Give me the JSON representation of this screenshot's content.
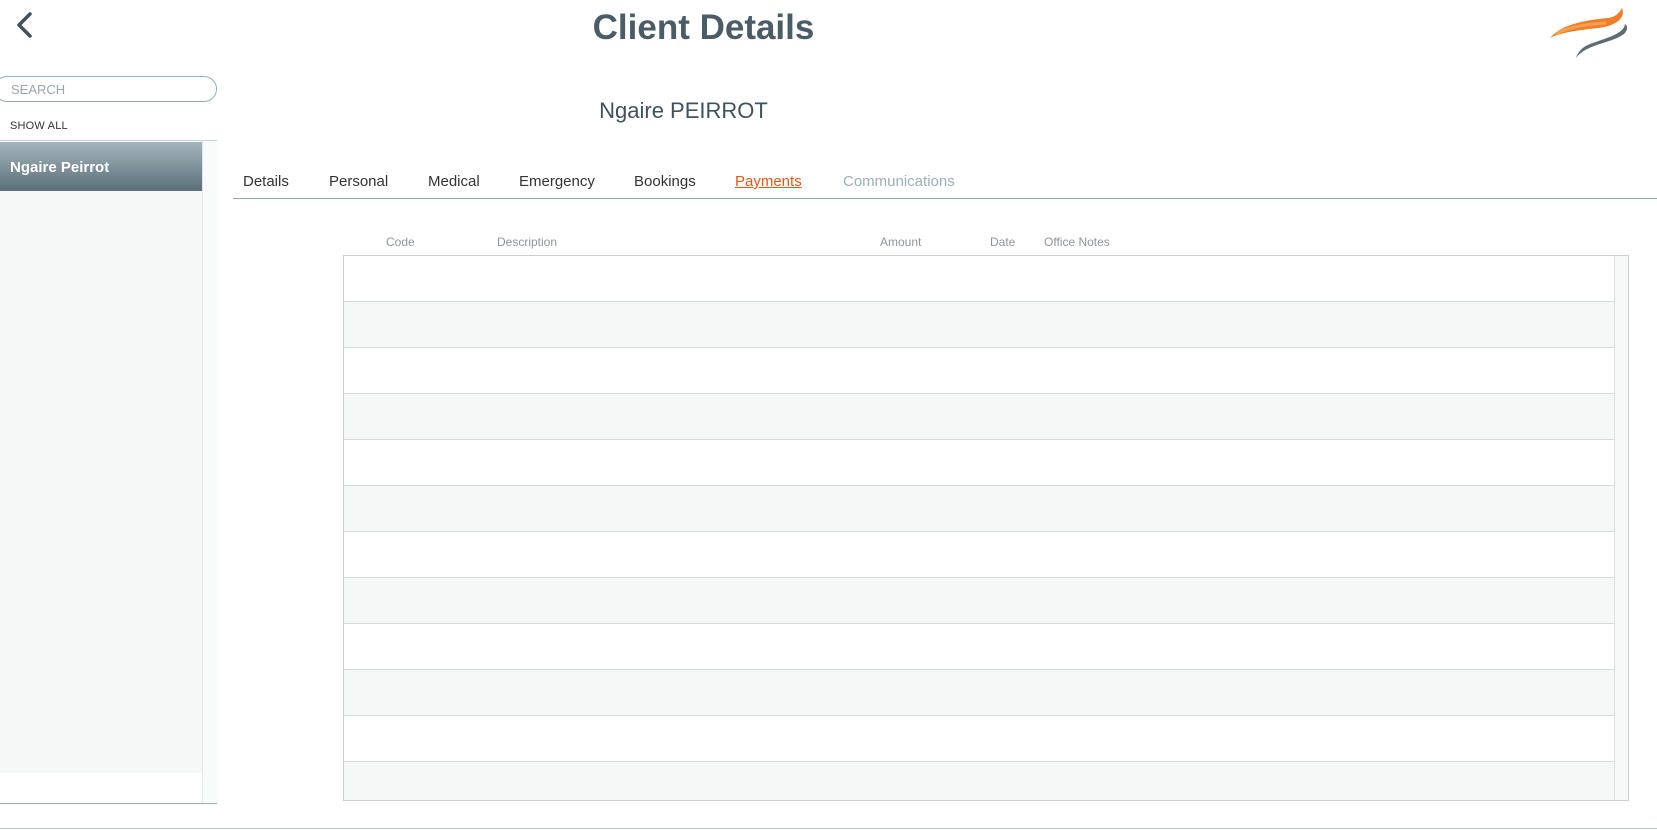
{
  "header": {
    "title": "Client Details",
    "back_icon": "chevron-left-icon",
    "logo": "brand-swoosh-logo"
  },
  "sidebar": {
    "search_placeholder": "SEARCH",
    "show_all_label": "SHOW ALL",
    "clients": [
      {
        "name": "Ngaire Peirrot",
        "selected": true
      }
    ]
  },
  "client": {
    "display_name": "Ngaire PEIRROT"
  },
  "tabs": [
    {
      "label": "Details",
      "state": "normal"
    },
    {
      "label": "Personal",
      "state": "normal"
    },
    {
      "label": "Medical",
      "state": "normal"
    },
    {
      "label": "Emergency",
      "state": "normal"
    },
    {
      "label": "Bookings",
      "state": "normal"
    },
    {
      "label": "Payments",
      "state": "active"
    },
    {
      "label": "Communications",
      "state": "disabled"
    }
  ],
  "payments_table": {
    "columns": [
      "Code",
      "Description",
      "Amount",
      "Date",
      "Office Notes"
    ],
    "rows": []
  },
  "colors": {
    "accent": "#e8561b",
    "title": "#4a5d67",
    "selected_item_top": "#a5b5bc",
    "selected_item_bottom": "#5a6f79",
    "disabled_tab": "#99b0b6"
  }
}
